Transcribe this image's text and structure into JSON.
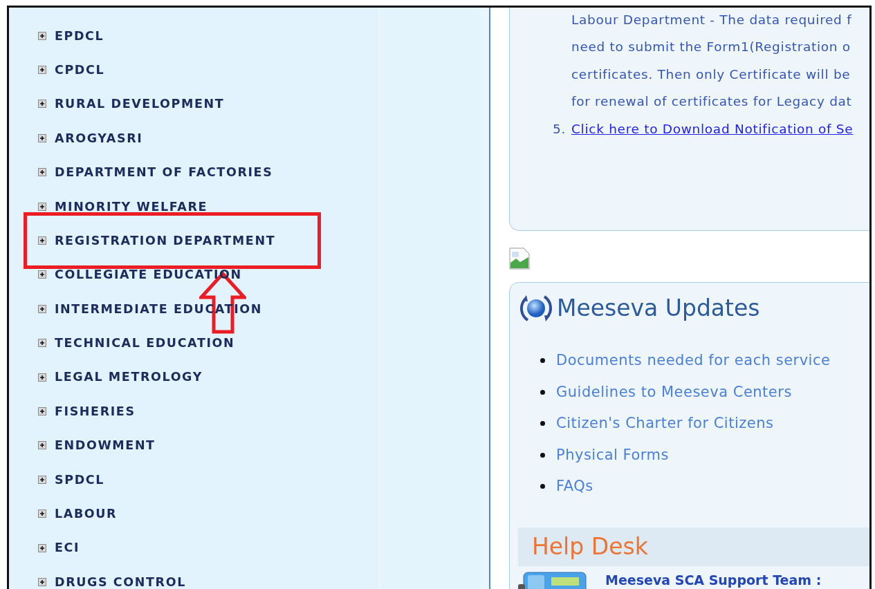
{
  "sidebar": {
    "items": [
      {
        "label": "EPDCL",
        "highlighted": false
      },
      {
        "label": "CPDCL",
        "highlighted": false
      },
      {
        "label": "RURAL DEVELOPMENT",
        "highlighted": false
      },
      {
        "label": "AROGYASRI",
        "highlighted": false
      },
      {
        "label": "DEPARTMENT OF FACTORIES",
        "highlighted": false
      },
      {
        "label": "MINORITY WELFARE",
        "highlighted": false
      },
      {
        "label": "REGISTRATION DEPARTMENT",
        "highlighted": true
      },
      {
        "label": "COLLEGIATE EDUCATION",
        "highlighted": false
      },
      {
        "label": "INTERMEDIATE EDUCATION",
        "highlighted": false
      },
      {
        "label": "TECHNICAL EDUCATION",
        "highlighted": false
      },
      {
        "label": "LEGAL METROLOGY",
        "highlighted": false
      },
      {
        "label": "FISHERIES",
        "highlighted": false
      },
      {
        "label": "ENDOWMENT",
        "highlighted": false
      },
      {
        "label": "SPDCL",
        "highlighted": false
      },
      {
        "label": "LABOUR",
        "highlighted": false
      },
      {
        "label": "ECI",
        "highlighted": false
      },
      {
        "label": "DRUGS CONTROL",
        "highlighted": false
      }
    ]
  },
  "notice": {
    "lines": [
      {
        "kind": "text",
        "text": "Labour Department - The data required f"
      },
      {
        "kind": "text",
        "text": "need to submit the Form1(Registration o"
      },
      {
        "kind": "text",
        "text": "certificates. Then only Certificate will be"
      },
      {
        "kind": "text",
        "text": "for renewal of certificates for Legacy dat"
      },
      {
        "kind": "link",
        "number": "5.",
        "text": "Click here to Download Notification of Se"
      }
    ]
  },
  "updates": {
    "title": "Meeseva Updates",
    "links": [
      "Documents needed for each service",
      "Guidelines to Meeseva Centers",
      "Citizen's Charter for Citizens",
      "Physical Forms",
      "FAQs"
    ]
  },
  "help_desk": {
    "title": "Help Desk",
    "contacts": [
      {
        "name": "Meeseva SCA Support Team :"
      }
    ]
  }
}
